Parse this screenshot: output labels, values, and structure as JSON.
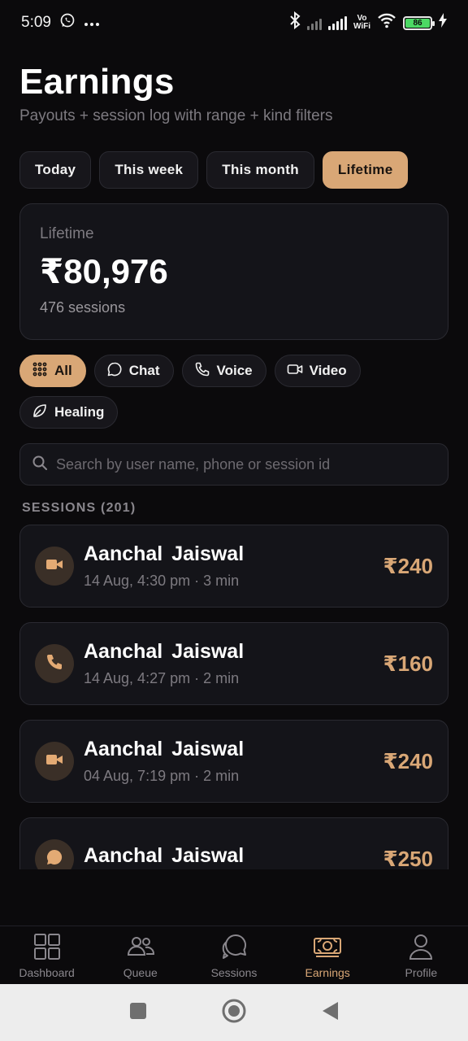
{
  "status_bar": {
    "time": "5:09",
    "battery": "86",
    "vowifi_top": "Vo",
    "vowifi_bottom": "WiFi"
  },
  "header": {
    "title": "Earnings",
    "subtitle": "Payouts + session log with range + kind filters"
  },
  "range_tabs": [
    {
      "label": "Today",
      "active": false
    },
    {
      "label": "This week",
      "active": false
    },
    {
      "label": "This month",
      "active": false
    },
    {
      "label": "Lifetime",
      "active": true
    }
  ],
  "summary": {
    "label": "Lifetime",
    "amount": "₹80,976",
    "sessions": "476 sessions"
  },
  "kind_filters": [
    {
      "label": "All",
      "icon": "grid-dots-icon",
      "active": true
    },
    {
      "label": "Chat",
      "icon": "chat-bubble-icon",
      "active": false
    },
    {
      "label": "Voice",
      "icon": "phone-icon",
      "active": false
    },
    {
      "label": "Video",
      "icon": "video-camera-icon",
      "active": false
    },
    {
      "label": "Healing",
      "icon": "leaf-icon",
      "active": false
    }
  ],
  "search": {
    "placeholder": "Search by user name, phone or session id"
  },
  "sessions_heading": "SESSIONS (201)",
  "sessions": [
    {
      "name": "Aanchal  Jaiswal",
      "meta": "14 Aug, 4:30 pm · 3 min",
      "amount": "₹240",
      "kind_icon": "video-camera-icon"
    },
    {
      "name": "Aanchal  Jaiswal",
      "meta": "14 Aug, 4:27 pm · 2 min",
      "amount": "₹160",
      "kind_icon": "phone-icon"
    },
    {
      "name": "Aanchal  Jaiswal",
      "meta": "04 Aug, 7:19 pm · 2 min",
      "amount": "₹240",
      "kind_icon": "video-camera-icon"
    },
    {
      "name": "Aanchal  Jaiswal",
      "meta": "",
      "amount": "₹250",
      "kind_icon": "chat-bubble-icon"
    }
  ],
  "bottom_nav": [
    {
      "label": "Dashboard",
      "icon": "dashboard-grid-icon",
      "active": false
    },
    {
      "label": "Queue",
      "icon": "users-icon",
      "active": false
    },
    {
      "label": "Sessions",
      "icon": "chat-bubbles-icon",
      "active": false
    },
    {
      "label": "Earnings",
      "icon": "money-icon",
      "active": true
    },
    {
      "label": "Profile",
      "icon": "person-icon",
      "active": false
    }
  ],
  "colors": {
    "accent": "#d9a776",
    "background": "#0b0a0c",
    "card": "#141419"
  }
}
